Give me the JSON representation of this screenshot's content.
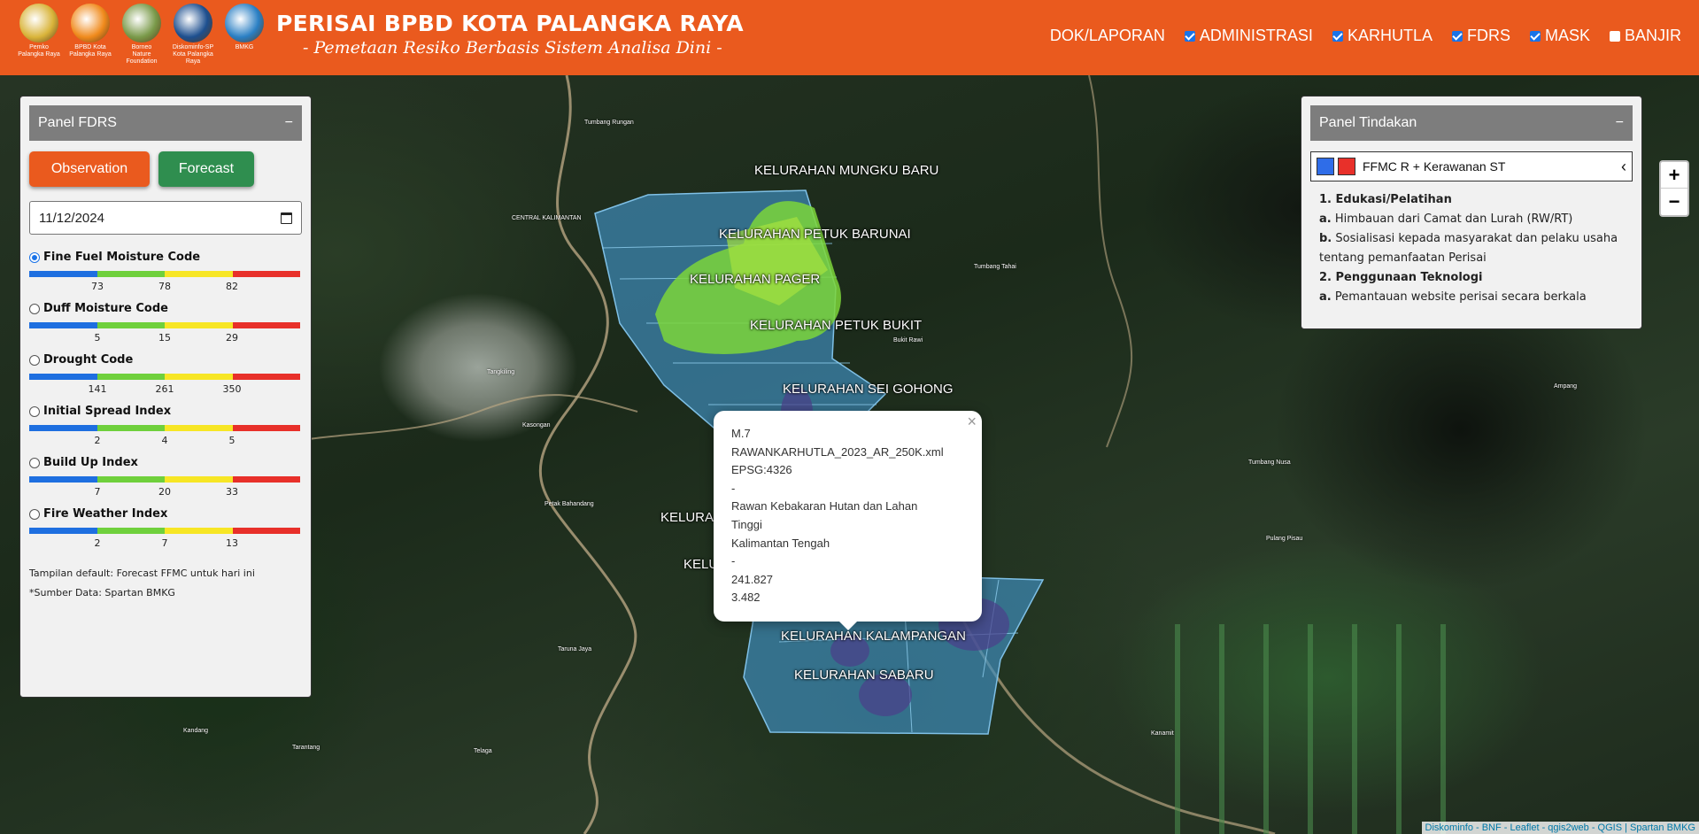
{
  "header": {
    "logos": [
      {
        "name": "pemko-logo",
        "caption": "Pemko\nPalangka Raya",
        "color": "#d9b43a"
      },
      {
        "name": "bpbd-logo",
        "caption": "BPBD Kota\nPalangka Raya",
        "color": "#f08a1c"
      },
      {
        "name": "bnf-logo",
        "caption": "Borneo\nNature\nFoundation",
        "color": "#7a9a4a"
      },
      {
        "name": "diskominfo-logo",
        "caption": "Diskominfo-SP\nKota Palangka Raya",
        "color": "#1d4f8f"
      },
      {
        "name": "bmkg-logo",
        "caption": "BMKG",
        "color": "#2a7fc4"
      }
    ],
    "title": "PERISAI BPBD KOTA PALANGKA RAYA",
    "subtitle": "- Pemetaan Resiko Berbasis Sistem Analisa Dini -",
    "nav": [
      {
        "label": "DOK/LAPORAN",
        "checkbox": false,
        "checked": false
      },
      {
        "label": "ADMINISTRASI",
        "checkbox": true,
        "checked": true
      },
      {
        "label": "KARHUTLA",
        "checkbox": true,
        "checked": true
      },
      {
        "label": "FDRS",
        "checkbox": true,
        "checked": true
      },
      {
        "label": "MASK",
        "checkbox": true,
        "checked": true
      },
      {
        "label": "BANJIR",
        "checkbox": true,
        "checked": false
      }
    ]
  },
  "fdrs_panel": {
    "title": "Panel FDRS",
    "minimize": "−",
    "observation_label": "Observation",
    "forecast_label": "Forecast",
    "date_value": "11/12/2024",
    "scale_colors": [
      "#1e6fe0",
      "#6fd03c",
      "#f7e625",
      "#e8302a"
    ],
    "indices": [
      {
        "name": "Fine Fuel Moisture Code",
        "selected": true,
        "ticks": [
          "73",
          "78",
          "82"
        ]
      },
      {
        "name": "Duff Moisture Code",
        "selected": false,
        "ticks": [
          "5",
          "15",
          "29"
        ]
      },
      {
        "name": "Drought Code",
        "selected": false,
        "ticks": [
          "141",
          "261",
          "350"
        ]
      },
      {
        "name": "Initial Spread Index",
        "selected": false,
        "ticks": [
          "2",
          "4",
          "5"
        ]
      },
      {
        "name": "Build Up Index",
        "selected": false,
        "ticks": [
          "7",
          "20",
          "33"
        ]
      },
      {
        "name": "Fire Weather Index",
        "selected": false,
        "ticks": [
          "2",
          "7",
          "13"
        ]
      }
    ],
    "note_default": "Tampilan default: Forecast FFMC untuk hari ini",
    "note_source": "*Sumber Data: Spartan BMKG"
  },
  "tindakan_panel": {
    "title": "Panel Tindakan",
    "minimize": "−",
    "select_label": "FFMC R + Kerawanan ST",
    "swatch_colors": [
      "#2f6de8",
      "#e8302a"
    ],
    "items": [
      {
        "type": "heading",
        "text": "1. Edukasi/Pelatihan"
      },
      {
        "type": "item",
        "key": "a.",
        "text": "Himbauan dari Camat dan Lurah (RW/RT)"
      },
      {
        "type": "item",
        "key": "b.",
        "text": "Sosialisasi kepada masyarakat dan pelaku usaha tentang pemanfaatan Perisai"
      },
      {
        "type": "heading",
        "text": "2. Penggunaan Teknologi"
      },
      {
        "type": "item",
        "key": "a.",
        "text": "Pemantauan website perisai secara berkala"
      }
    ]
  },
  "map": {
    "zoom_in": "+",
    "zoom_out": "−",
    "kelurahan_labels": [
      "KELURAHAN MUNGKU BARU",
      "KELURAHAN PETUK BARUNAI",
      "KELURAHAN PAGER",
      "KELURAHAN PETUK BUKIT",
      "KELURAHAN SEI GOHONG",
      "KELURA",
      "KELUR",
      "KELURAHAN KALAMPANGAN",
      "KELURAHAN SABARU"
    ],
    "places": [
      "Tumbang Rungan",
      "CENTRAL KALIMANTAN",
      "Tangkiling",
      "Kasongan",
      "Petak Bahandang",
      "Tumbang Tahai",
      "Bukit Rawi",
      "Ampang",
      "Tumbang Nusa",
      "Pulang Pisau",
      "Kanamit",
      "Kandang",
      "Taruna Jaya",
      "Tarantang",
      "Telaga"
    ],
    "popup": {
      "lines": [
        "M.7",
        "RAWANKARHUTLA_2023_AR_250K.xml",
        "EPSG:4326",
        "-",
        "Rawan Kebakaran Hutan dan Lahan",
        "Tinggi",
        "Kalimantan Tengah",
        "-",
        "241.827",
        "3.482"
      ],
      "close": "×"
    },
    "attribution": "Diskominfo - BNF - Leaflet - qgis2web - QGIS | Spartan BMKG"
  }
}
